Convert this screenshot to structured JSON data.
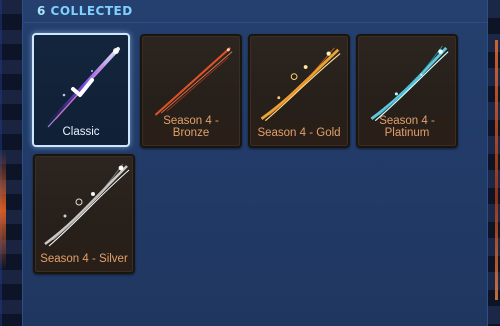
{
  "header": {
    "count": "6",
    "label": "COLLECTED"
  },
  "items": [
    {
      "name": "Classic",
      "selected": true,
      "icon": "boost-trail-purple",
      "color": "#b58cff"
    },
    {
      "name": "Season 4 - Bronze",
      "selected": false,
      "icon": "boost-trail-bronze",
      "color": "#ff6a3a"
    },
    {
      "name": "Season 4 - Gold",
      "selected": false,
      "icon": "boost-trail-gold",
      "color": "#ffb347"
    },
    {
      "name": "Season 4 - Platinum",
      "selected": false,
      "icon": "boost-trail-platinum",
      "color": "#8ff0ff"
    },
    {
      "name": "Season 4 - Silver",
      "selected": false,
      "icon": "boost-trail-silver",
      "color": "#f0f0f0"
    }
  ],
  "icons": {
    "selected_marker": "checkmark-icon"
  }
}
